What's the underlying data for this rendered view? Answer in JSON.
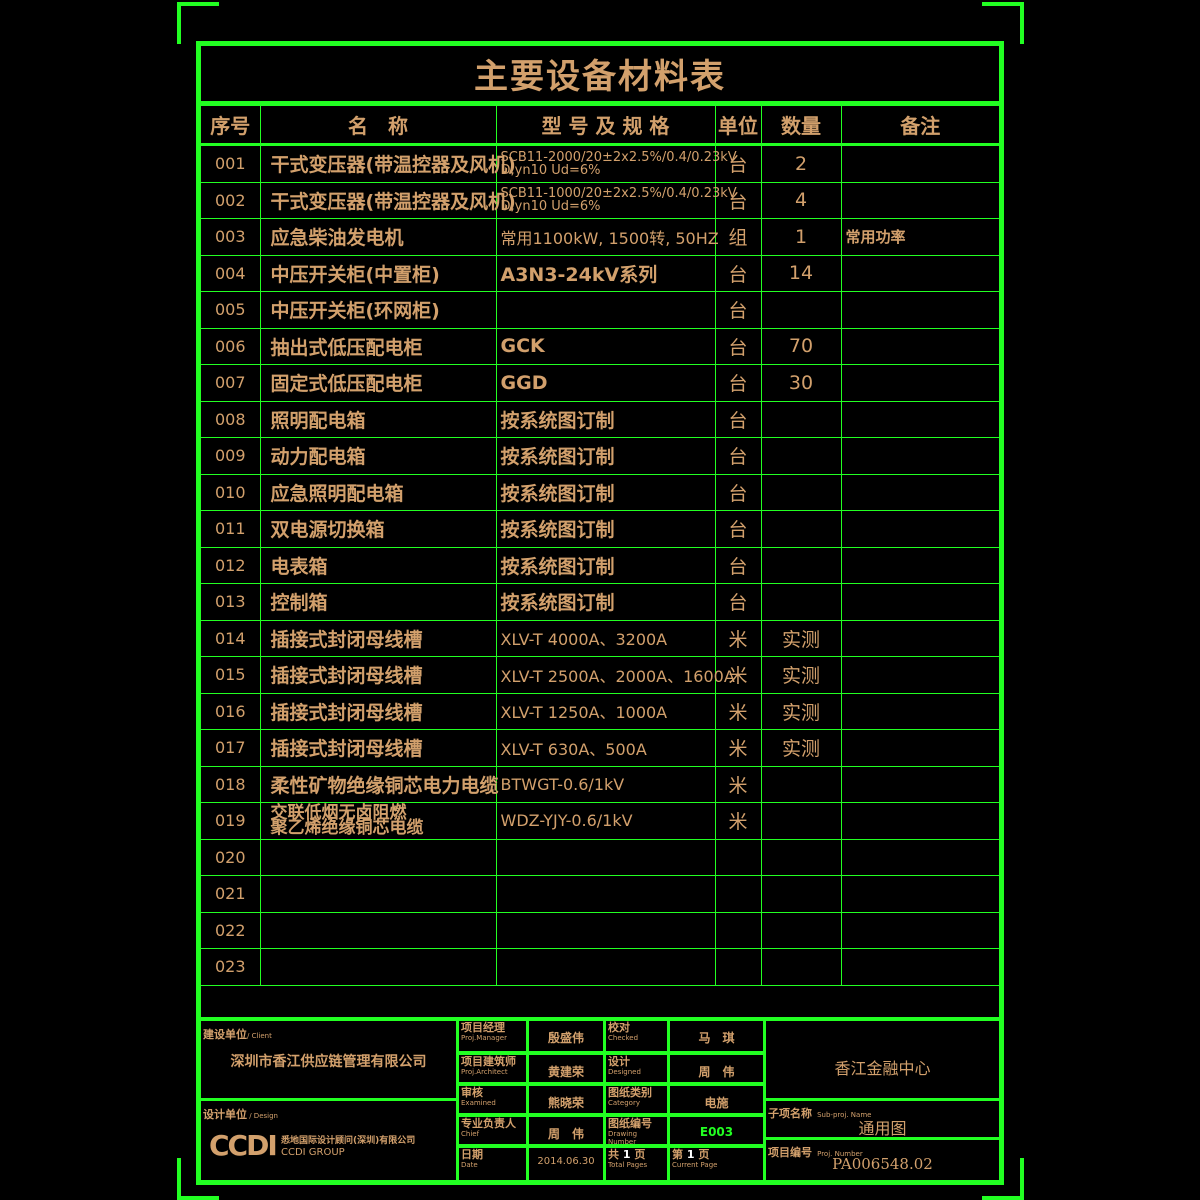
{
  "title": "主要设备材料表",
  "columns": [
    "序号",
    "名　称",
    "型 号 及 规 格",
    "单位",
    "数量",
    "备注"
  ],
  "rows": [
    {
      "no": "001",
      "name": "干式变压器(带温控器及风机)",
      "spec": "SCB11-2000/20±2x2.5%/0.4/0.23kV\nD,yn10 Ud=6%",
      "unit": "台",
      "qty": "2",
      "remark": ""
    },
    {
      "no": "002",
      "name": "干式变压器(带温控器及风机)",
      "spec": "SCB11-1000/20±2x2.5%/0.4/0.23kV\nD,yn10 Ud=6%",
      "unit": "台",
      "qty": "4",
      "remark": ""
    },
    {
      "no": "003",
      "name": "应急柴油发电机",
      "spec": "常用1100kW, 1500转, 50HZ",
      "unit": "组",
      "qty": "1",
      "remark": "常用功率"
    },
    {
      "no": "004",
      "name": "中压开关柜(中置柜)",
      "spec": "A3N3-24kV系列",
      "unit": "台",
      "qty": "14",
      "remark": ""
    },
    {
      "no": "005",
      "name": "中压开关柜(环网柜)",
      "spec": "",
      "unit": "台",
      "qty": "",
      "remark": ""
    },
    {
      "no": "006",
      "name": "抽出式低压配电柜",
      "spec": "GCK",
      "unit": "台",
      "qty": "70",
      "remark": ""
    },
    {
      "no": "007",
      "name": "固定式低压配电柜",
      "spec": "GGD",
      "unit": "台",
      "qty": "30",
      "remark": ""
    },
    {
      "no": "008",
      "name": "照明配电箱",
      "spec": "按系统图订制",
      "unit": "台",
      "qty": "",
      "remark": ""
    },
    {
      "no": "009",
      "name": "动力配电箱",
      "spec": "按系统图订制",
      "unit": "台",
      "qty": "",
      "remark": ""
    },
    {
      "no": "010",
      "name": "应急照明配电箱",
      "spec": "按系统图订制",
      "unit": "台",
      "qty": "",
      "remark": ""
    },
    {
      "no": "011",
      "name": "双电源切换箱",
      "spec": "按系统图订制",
      "unit": "台",
      "qty": "",
      "remark": ""
    },
    {
      "no": "012",
      "name": "电表箱",
      "spec": "按系统图订制",
      "unit": "台",
      "qty": "",
      "remark": ""
    },
    {
      "no": "013",
      "name": "控制箱",
      "spec": "按系统图订制",
      "unit": "台",
      "qty": "",
      "remark": ""
    },
    {
      "no": "014",
      "name": "插接式封闭母线槽",
      "spec": "XLV-T 4000A、3200A",
      "unit": "米",
      "qty": "实测",
      "remark": ""
    },
    {
      "no": "015",
      "name": "插接式封闭母线槽",
      "spec": "XLV-T 2500A、2000A、1600A",
      "unit": "米",
      "qty": "实测",
      "remark": ""
    },
    {
      "no": "016",
      "name": "插接式封闭母线槽",
      "spec": "XLV-T 1250A、1000A",
      "unit": "米",
      "qty": "实测",
      "remark": ""
    },
    {
      "no": "017",
      "name": "插接式封闭母线槽",
      "spec": "XLV-T 630A、500A",
      "unit": "米",
      "qty": "实测",
      "remark": ""
    },
    {
      "no": "018",
      "name": "柔性矿物绝缘铜芯电力电缆",
      "spec": "BTWGT-0.6/1kV",
      "unit": "米",
      "qty": "",
      "remark": ""
    },
    {
      "no": "019",
      "name": "交联低烟无卤阻燃\n聚乙烯绝缘铜芯电缆",
      "spec": "WDZ-YJY-0.6/1kV",
      "unit": "米",
      "qty": "",
      "remark": ""
    },
    {
      "no": "020",
      "name": "",
      "spec": "",
      "unit": "",
      "qty": "",
      "remark": ""
    },
    {
      "no": "021",
      "name": "",
      "spec": "",
      "unit": "",
      "qty": "",
      "remark": ""
    },
    {
      "no": "022",
      "name": "",
      "spec": "",
      "unit": "",
      "qty": "",
      "remark": ""
    },
    {
      "no": "023",
      "name": "",
      "spec": "",
      "unit": "",
      "qty": "",
      "remark": ""
    }
  ],
  "title_block": {
    "client_label_cn": "建设单位",
    "client_label_en": "/ Client",
    "client": "深圳市香江供应链管理有限公司",
    "design_label_cn": "设计单位",
    "design_label_en": " / Design",
    "design_logo": "CCDI",
    "design_company_cn": "悉地国际设计顾问(深圳)有限公司",
    "design_company_en": "CCDI GROUP",
    "pm_cn": "项目经理",
    "pm_en": "Proj.Manager",
    "pm": "殷盛伟",
    "arch_cn": "项目建筑师",
    "arch_en": "Proj.Architect",
    "arch": "黄建荣",
    "exam_cn": "审核",
    "exam_en": "Examined",
    "exam": "熊晓荣",
    "chief_cn": "专业负责人",
    "chief_en": "Chief",
    "chief": "周　伟",
    "date_cn": "日期",
    "date_en": "Date",
    "date": "2014.06.30",
    "checked_cn": "校对",
    "checked_en": "Checked",
    "checked": "马　琪",
    "designed_cn": "设计",
    "designed_en": "Designed",
    "designed": "周　伟",
    "category_cn": "图纸类别",
    "category_en": "Category",
    "category": "电施",
    "drawing_no_cn": "图纸编号",
    "drawing_no_en": "Drawing Number",
    "drawing_no": "E003",
    "total_pages_cn": "共",
    "total_pages": "1",
    "total_pages_unit": "页",
    "total_pages_en": "Total Pages",
    "current_page_cn": "第",
    "current_page": "1",
    "current_page_unit": "页",
    "current_page_en": "Current Page",
    "project": "香江金融中心",
    "subproj_label_cn": "子项名称",
    "subproj_label_en": "Sub-proj. Name",
    "subproj": "通用图",
    "projno_label_cn": "项目编号",
    "projno_label_en": "Proj. Number",
    "projno": "PA006548.02"
  },
  "colors": {
    "line": "#22ff22",
    "text": "#d2a06c",
    "drawing_no": "#22ff22",
    "background": "#000000"
  }
}
